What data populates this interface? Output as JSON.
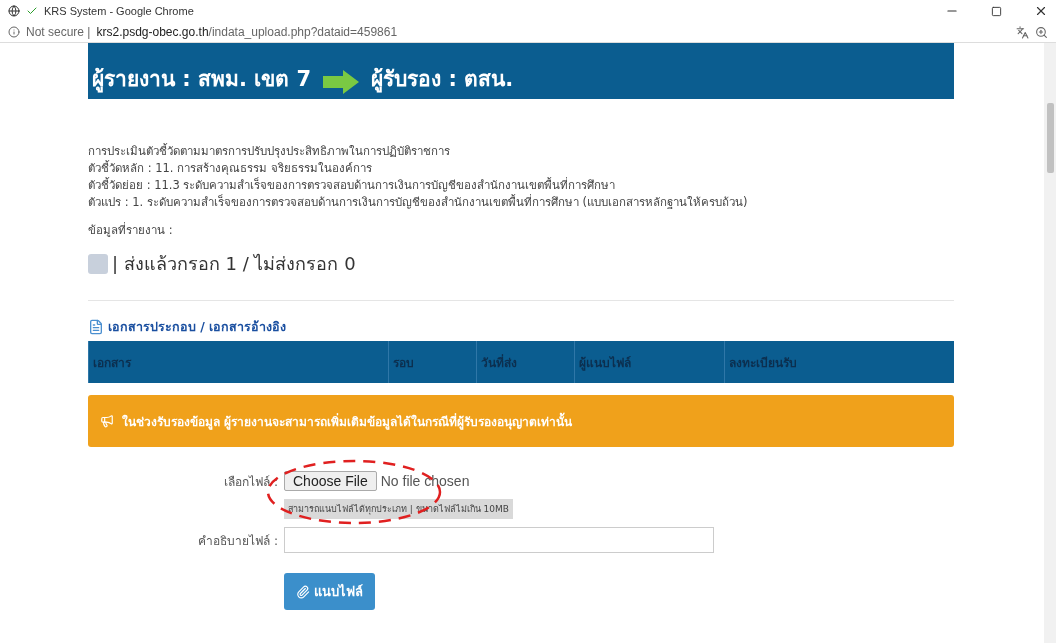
{
  "window": {
    "title": "KRS System - Google Chrome"
  },
  "address_bar": {
    "security": "Not secure |",
    "host": "krs2.psdg-obec.go.th",
    "path": "/indata_upload.php?dataid=459861"
  },
  "header": {
    "reporter": "ผู้รายงาน : สพม. เขต 7",
    "certifier": "ผู้รับรอง : ตสน."
  },
  "details": [
    "การประเมินตัวชี้วัดตามมาตรการปรับปรุงประสิทธิภาพในการปฏิบัติราชการ",
    "ตัวชี้วัดหลัก : 11. การสร้างคุณธรรม จริยธรรมในองค์การ",
    "ตัวชี้วัดย่อย : 11.3 ระดับความสำเร็จของการตรวจสอบด้านการเงินการบัญชีของสำนักงานเขตพื้นที่การศึกษา",
    "ตัวแปร : 1. ระดับความสำเร็จของการตรวจสอบด้านการเงินการบัญชีของสำนักงานเขตพื้นที่การศึกษา (แบบเอกสารหลักฐานให้ครบถ้วน)"
  ],
  "reported_label": "ข้อมูลที่รายงาน :",
  "reported": {
    "checked": false,
    "text": "| ส่งแล้วกรอก 1 / ไม่ส่งกรอก 0"
  },
  "documents": {
    "title": "เอกสารประกอบ / เอกสารอ้างอิง",
    "columns": [
      "เอกสาร",
      "รอบ",
      "วันที่ส่ง",
      "ผู้แนบไฟล์",
      "ลงทะเบียนรับ"
    ]
  },
  "notice": "ในช่วงรับรองข้อมูล ผู้รายงานจะสามารถเพิ่มเติมข้อมูลได้ในกรณีที่ผู้รับรองอนุญาตเท่านั้น",
  "upload": {
    "file_label": "เลือกไฟล์ :",
    "choose_button": "Choose File",
    "file_status": "No file chosen",
    "hint": "สามารถแนบไฟล์ได้ทุกประเภท | ขนาดไฟล์ไม่เกิน 10MB",
    "description_label": "คำอธิบายไฟล์ :",
    "attach_button": "แนบไฟล์"
  }
}
